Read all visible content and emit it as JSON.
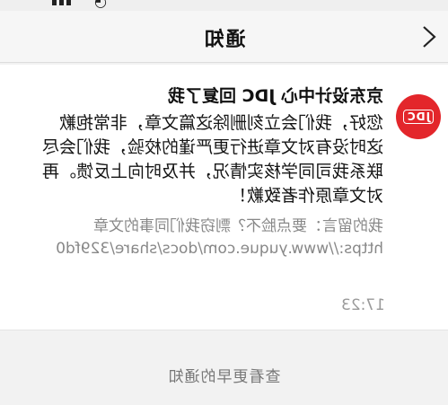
{
  "nav": {
    "title": "通知"
  },
  "notification": {
    "sender": "京东设计中心 JDC 回复了我",
    "body_lines": [
      "您好，我们会立刻删除这篇文章，非常抱歉",
      "这时没有对文章进行更严谨的校验，我们会尽",
      "联系我司同学核实情况，并及时向上反馈。再",
      "对文章原作者致歉！"
    ],
    "reply_lines": [
      "我的留言：要点脸不？剽窃我们同事的文章",
      "https://www.yuque.com/docs/share/329fd0"
    ],
    "time": "17:23",
    "avatar_label": "JDC"
  },
  "footer": {
    "more_label": "查看更早的通知"
  },
  "colors": {
    "avatar_bg": "#e3262b",
    "page_bg": "#f2f2f2"
  }
}
